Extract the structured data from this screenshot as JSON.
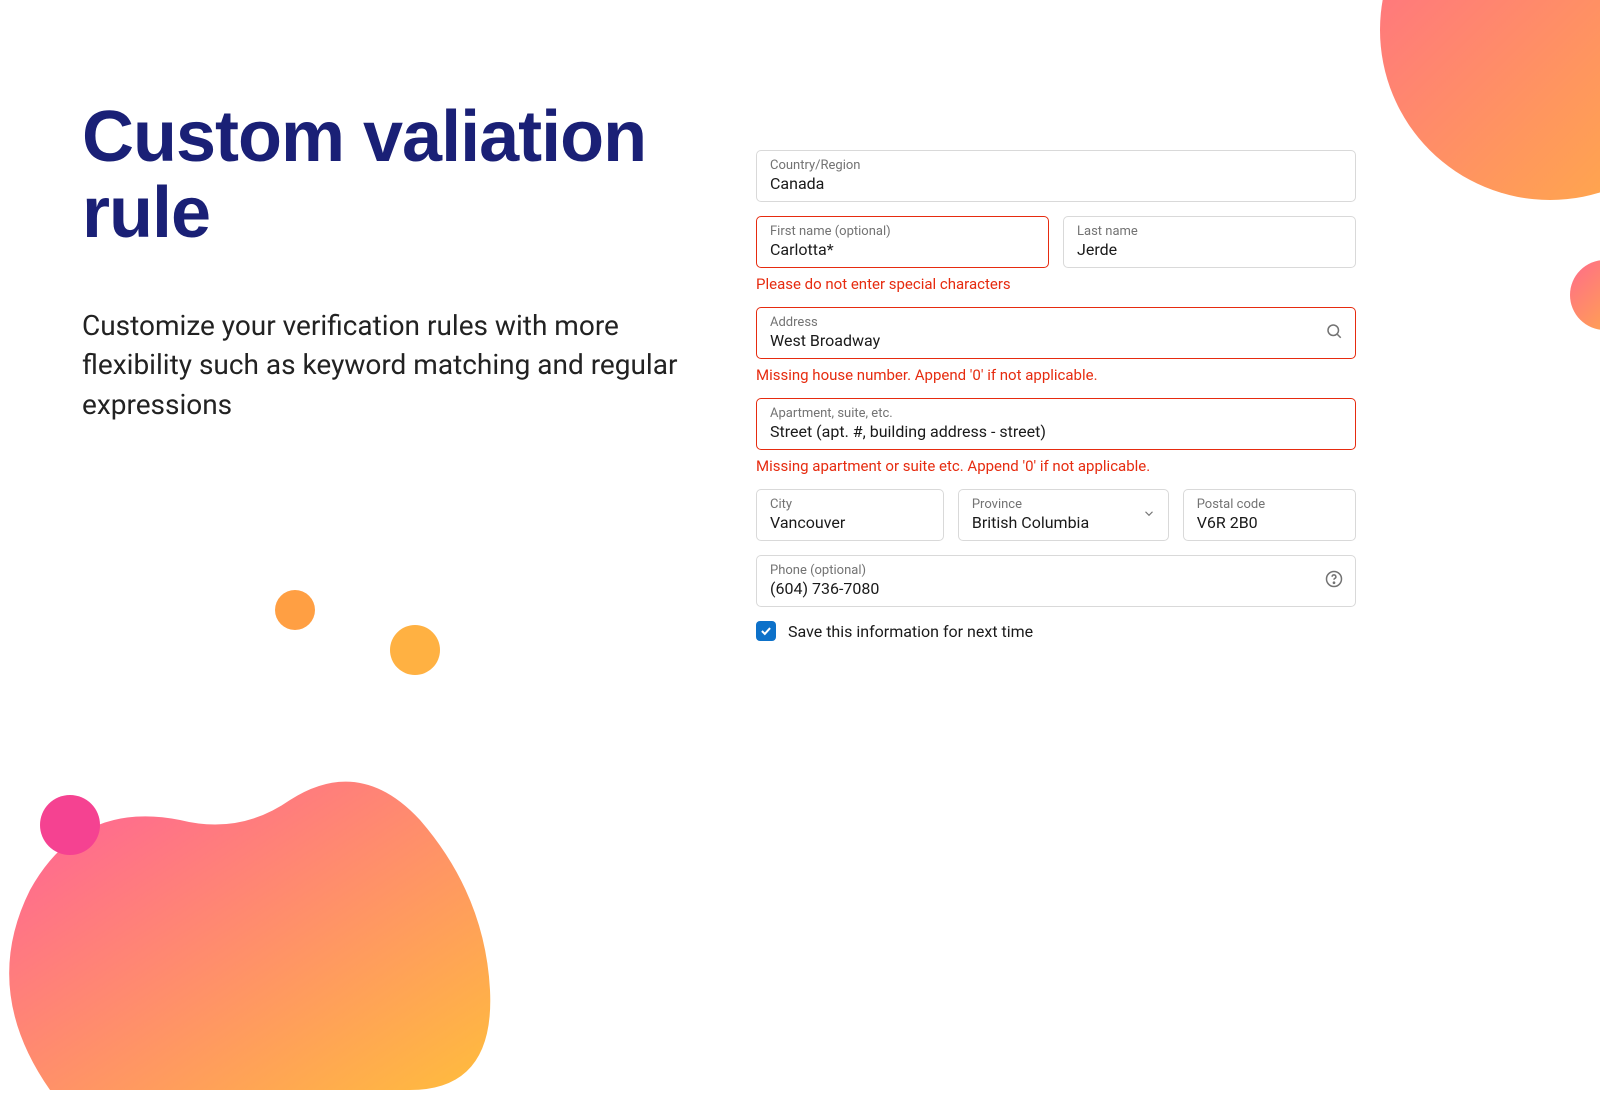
{
  "left": {
    "heading": "Custom valiation rule",
    "description": "Customize your verification rules with more flexibility such as keyword matching and regular expressions"
  },
  "form": {
    "country": {
      "label": "Country/Region",
      "value": "Canada"
    },
    "firstName": {
      "label": "First name (optional)",
      "value": "Carlotta*",
      "error": "Please do not enter special characters"
    },
    "lastName": {
      "label": "Last name",
      "value": "Jerde"
    },
    "address": {
      "label": "Address",
      "value": "West Broadway",
      "error": "Missing house number. Append '0' if not applicable."
    },
    "apartment": {
      "label": "Apartment, suite, etc.",
      "value": "Street (apt. #, building address - street)",
      "error": "Missing apartment or suite etc. Append '0' if not applicable."
    },
    "city": {
      "label": "City",
      "value": "Vancouver"
    },
    "province": {
      "label": "Province",
      "value": "British Columbia"
    },
    "postal": {
      "label": "Postal code",
      "value": "V6R 2B0"
    },
    "phone": {
      "label": "Phone (optional)",
      "value": "(604) 736-7080"
    },
    "saveInfo": {
      "label": "Save this information for next time",
      "checked": true
    }
  }
}
